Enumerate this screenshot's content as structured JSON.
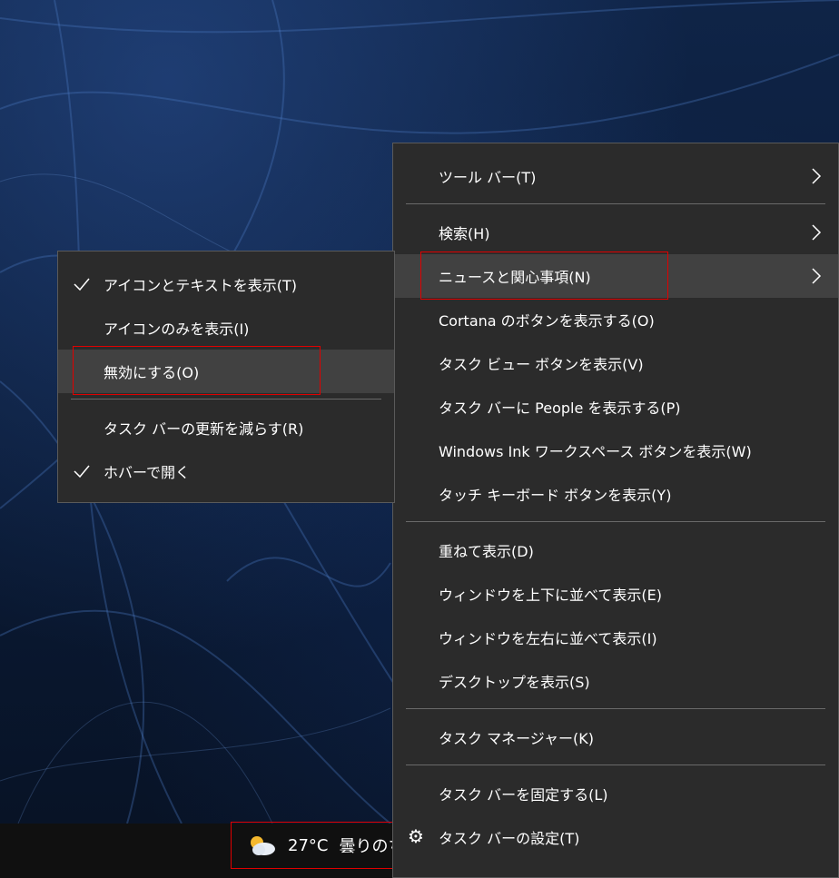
{
  "context_menu": {
    "items": [
      {
        "label": "ツール バー(T)",
        "submenu": true
      },
      {
        "label": "検索(H)",
        "submenu": true
      },
      {
        "label": "ニュースと関心事項(N)",
        "submenu": true
      },
      {
        "label": "Cortana のボタンを表示する(O)"
      },
      {
        "label": "タスク ビュー ボタンを表示(V)"
      },
      {
        "label": "タスク バーに People を表示する(P)"
      },
      {
        "label": "Windows Ink ワークスペース ボタンを表示(W)"
      },
      {
        "label": "タッチ キーボード ボタンを表示(Y)"
      },
      {
        "label": "重ねて表示(D)"
      },
      {
        "label": "ウィンドウを上下に並べて表示(E)"
      },
      {
        "label": "ウィンドウを左右に並べて表示(I)"
      },
      {
        "label": "デスクトップを表示(S)"
      },
      {
        "label": "タスク マネージャー(K)"
      },
      {
        "label": "タスク バーを固定する(L)"
      },
      {
        "label": "タスク バーの設定(T)",
        "icon": "gear-icon"
      }
    ]
  },
  "news_submenu": {
    "items": [
      {
        "label": "アイコンとテキストを表示(T)",
        "checked": true
      },
      {
        "label": "アイコンのみを表示(I)",
        "checked": false
      },
      {
        "label": "無効にする(O)",
        "checked": false
      },
      {
        "label": "タスク バーの更新を減らす(R)",
        "checked": false
      },
      {
        "label": "ホバーで開く",
        "checked": true
      }
    ]
  },
  "taskbar": {
    "weather": {
      "icon": "partly-cloudy-icon",
      "temperature": "27°C",
      "condition": "曇りのち"
    }
  },
  "colors": {
    "menu_bg": "#2b2b2b",
    "hover_bg": "#414141",
    "highlight_red": "#e00000",
    "taskbar_bg": "#101010"
  }
}
